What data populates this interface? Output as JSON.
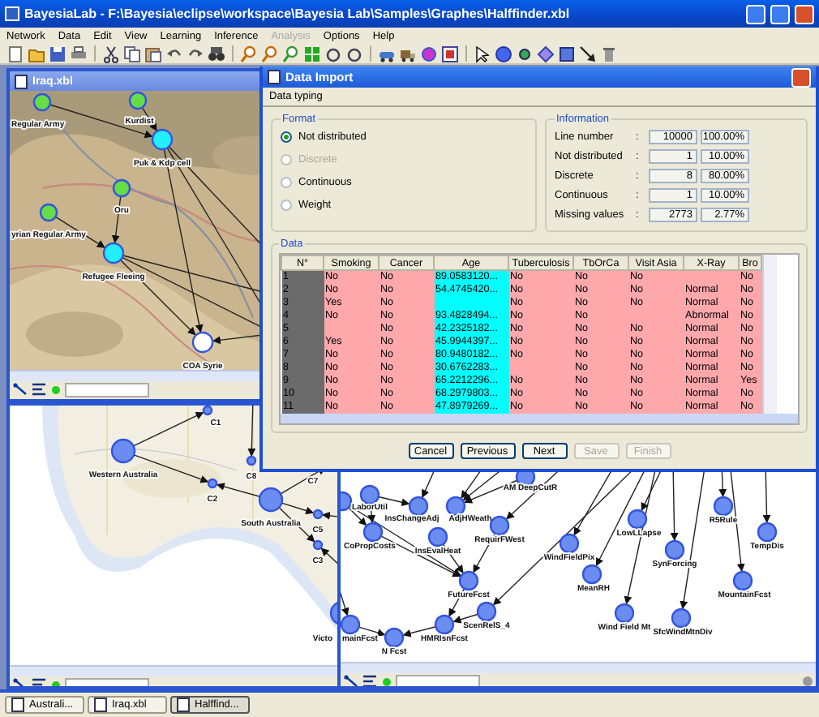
{
  "window": {
    "title": "BayesiaLab - F:\\Bayesia\\eclipse\\workspace\\Bayesia Lab\\Samples\\Graphes\\Halffinder.xbl"
  },
  "menu": [
    {
      "label": "Network",
      "disabled": false
    },
    {
      "label": "Data",
      "disabled": false
    },
    {
      "label": "Edit",
      "disabled": false
    },
    {
      "label": "View",
      "disabled": false
    },
    {
      "label": "Learning",
      "disabled": false
    },
    {
      "label": "Inference",
      "disabled": false
    },
    {
      "label": "Analysis",
      "disabled": true
    },
    {
      "label": "Options",
      "disabled": false
    },
    {
      "label": "Help",
      "disabled": false
    }
  ],
  "graph_windows": [
    {
      "title": "Iraq.xbl",
      "nodes": [
        {
          "label": "Regular Army",
          "color": "#66dd44"
        },
        {
          "label": "Kurdist",
          "color": "#66dd44"
        },
        {
          "label": "Puk & Kdp cell",
          "color": "#22eeff"
        },
        {
          "label": "Oru",
          "color": "#66dd44"
        },
        {
          "label": "yrian Regular Army",
          "color": "#66dd44"
        },
        {
          "label": "Refugee Fleeing",
          "color": "#22eeff"
        },
        {
          "label": "COA Syrie",
          "color": "#ffffff"
        }
      ]
    },
    {
      "nodes": [
        {
          "label": "Western Australia"
        },
        {
          "label": "C1"
        },
        {
          "label": "C2"
        },
        {
          "label": "C8"
        },
        {
          "label": "South Australia"
        },
        {
          "label": "C5"
        },
        {
          "label": "C3"
        },
        {
          "label": "Victo"
        },
        {
          "label": "C7"
        }
      ]
    },
    {
      "nodes": [
        {
          "label": "LaborUtil"
        },
        {
          "label": "InsChangeAdj"
        },
        {
          "label": "AdjHWeath"
        },
        {
          "label": "AM DeepCutR"
        },
        {
          "label": "CoPropCosts"
        },
        {
          "label": "InsEvalHeat"
        },
        {
          "label": "RequirFWest"
        },
        {
          "label": "WindFieldPix"
        },
        {
          "label": "FutureFcst"
        },
        {
          "label": "MeanRH"
        },
        {
          "label": "LowLLapse"
        },
        {
          "label": "SynForcing"
        },
        {
          "label": "R5Rule"
        },
        {
          "label": "TempDis"
        },
        {
          "label": "MountainFcst"
        },
        {
          "label": "Wind Field Mt"
        },
        {
          "label": "SfcWindMtnDiv"
        },
        {
          "label": "ScenRelS_4"
        },
        {
          "label": "mainFcst"
        },
        {
          "label": "N Fcst"
        },
        {
          "label": "HMRIsnFcst"
        }
      ]
    }
  ],
  "dialog": {
    "title": "Data Import",
    "tab": "Data typing",
    "format": {
      "title": "Format",
      "options": [
        {
          "label": "Not distributed",
          "selected": true,
          "disabled": false
        },
        {
          "label": "Discrete",
          "selected": false,
          "disabled": true
        },
        {
          "label": "Continuous",
          "selected": false,
          "disabled": false
        },
        {
          "label": "Weight",
          "selected": false,
          "disabled": false
        }
      ]
    },
    "information": {
      "title": "Information",
      "rows": [
        {
          "label": "Line number",
          "sep": ":",
          "value": "10000",
          "percent": "100.00%"
        },
        {
          "label": "Not distributed",
          "sep": ":",
          "value": "1",
          "percent": "10.00%"
        },
        {
          "label": "Discrete",
          "sep": ":",
          "value": "8",
          "percent": "80.00%"
        },
        {
          "label": "Continuous",
          "sep": ":",
          "value": "1",
          "percent": "10.00%"
        },
        {
          "label": "Missing values",
          "sep": ":",
          "value": "2773",
          "percent": "2.77%"
        }
      ]
    },
    "data": {
      "title": "Data",
      "columns": [
        {
          "label": "N°",
          "kind": "index"
        },
        {
          "label": "Smoking",
          "kind": "discrete"
        },
        {
          "label": "Cancer",
          "kind": "discrete"
        },
        {
          "label": "Age",
          "kind": "continuous"
        },
        {
          "label": "Tuberculosis",
          "kind": "discrete"
        },
        {
          "label": "TbOrCa",
          "kind": "discrete"
        },
        {
          "label": "Visit Asia",
          "kind": "discrete"
        },
        {
          "label": "X-Ray",
          "kind": "discrete"
        },
        {
          "label": "Bro",
          "kind": "discrete"
        }
      ],
      "rows": [
        [
          "1",
          "No",
          "No",
          "89.0583120...",
          "No",
          "No",
          "No",
          null,
          "No"
        ],
        [
          "2",
          "No",
          "No",
          "54.4745420...",
          "No",
          "No",
          "No",
          "Normal",
          "No"
        ],
        [
          "3",
          "Yes",
          "No",
          null,
          "No",
          "No",
          "No",
          "Normal",
          "No"
        ],
        [
          "4",
          "No",
          "No",
          "93.4828494...",
          "No",
          "No",
          null,
          "Abnormal",
          "No"
        ],
        [
          "5",
          null,
          "No",
          "42.2325182...",
          "No",
          "No",
          "No",
          "Normal",
          "No"
        ],
        [
          "6",
          "Yes",
          "No",
          "45.9944397...",
          "No",
          "No",
          "No",
          "Normal",
          "No"
        ],
        [
          "7",
          "No",
          "No",
          "80.9480182...",
          "No",
          "No",
          "No",
          "Normal",
          "No"
        ],
        [
          "8",
          "No",
          "No",
          "30.6762283...",
          null,
          "No",
          "No",
          "Normal",
          "No"
        ],
        [
          "9",
          "No",
          "No",
          "65.2212296...",
          "No",
          "No",
          "No",
          "Normal",
          "Yes"
        ],
        [
          "10",
          "No",
          "No",
          "68.2979803...",
          "No",
          "No",
          "No",
          "Normal",
          "No"
        ],
        [
          "11",
          "No",
          "No",
          "47.8979269...",
          "No",
          "No",
          "No",
          "Normal",
          "No"
        ]
      ]
    },
    "buttons": [
      {
        "label": "Cancel",
        "disabled": false
      },
      {
        "label": "Previous",
        "disabled": false
      },
      {
        "label": "Next",
        "disabled": false
      },
      {
        "label": "Save",
        "disabled": true
      },
      {
        "label": "Finish",
        "disabled": true
      }
    ]
  },
  "taskbar": [
    {
      "label": "Australi...",
      "selected": false
    },
    {
      "label": "Iraq.xbl",
      "selected": false
    },
    {
      "label": "Halffind...",
      "selected": true
    }
  ]
}
